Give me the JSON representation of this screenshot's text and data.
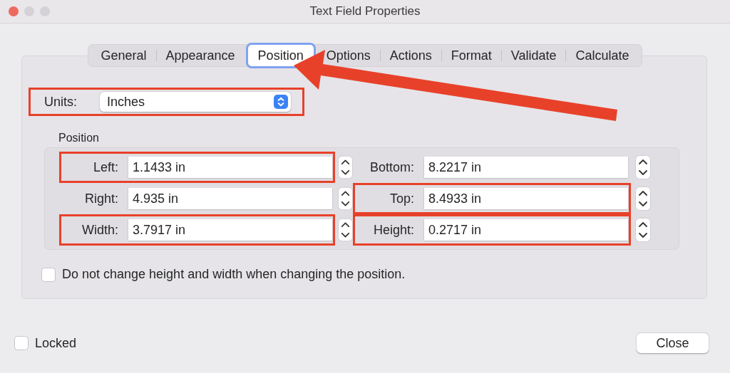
{
  "window": {
    "title": "Text Field Properties"
  },
  "tabs": [
    {
      "label": "General",
      "selected": false
    },
    {
      "label": "Appearance",
      "selected": false
    },
    {
      "label": "Position",
      "selected": true
    },
    {
      "label": "Options",
      "selected": false
    },
    {
      "label": "Actions",
      "selected": false
    },
    {
      "label": "Format",
      "selected": false
    },
    {
      "label": "Validate",
      "selected": false
    },
    {
      "label": "Calculate",
      "selected": false
    }
  ],
  "units": {
    "label": "Units:",
    "value": "Inches",
    "highlighted": true
  },
  "position_group": {
    "title": "Position",
    "fields": [
      {
        "label": "Left:",
        "value": "1.1433 in",
        "highlighted": true
      },
      {
        "label": "Bottom:",
        "value": "8.2217 in",
        "highlighted": false
      },
      {
        "label": "Right:",
        "value": "4.935 in",
        "highlighted": false
      },
      {
        "label": "Top:",
        "value": "8.4933 in",
        "highlighted": true
      },
      {
        "label": "Width:",
        "value": "3.7917 in",
        "highlighted": true
      },
      {
        "label": "Height:",
        "value": "0.2717 in",
        "highlighted": true
      }
    ]
  },
  "keep_size_checkbox": {
    "label": "Do not change height and width when changing the position.",
    "checked": false
  },
  "locked_checkbox": {
    "label": "Locked",
    "checked": false
  },
  "buttons": [
    "Close"
  ]
}
